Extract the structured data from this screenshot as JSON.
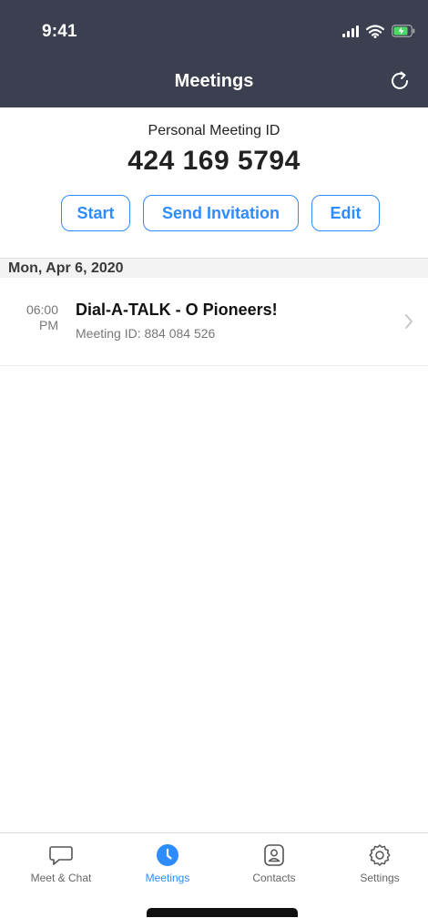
{
  "status_bar": {
    "time": "9:41"
  },
  "nav": {
    "title": "Meetings",
    "refresh_icon": "refresh-icon"
  },
  "personal_meeting": {
    "label": "Personal Meeting ID",
    "id": "424 169 5794",
    "buttons": {
      "start": "Start",
      "send_invitation": "Send Invitation",
      "edit": "Edit"
    }
  },
  "meetings": {
    "date_header": "Mon, Apr 6, 2020",
    "items": [
      {
        "time": "06:00",
        "ampm": "PM",
        "title": "Dial-A-TALK - O Pioneers!",
        "meeting_id": "Meeting ID: 884 084 526"
      }
    ]
  },
  "tabs": [
    {
      "label": "Meet & Chat",
      "icon": "chat-bubble-icon",
      "active": false
    },
    {
      "label": "Meetings",
      "icon": "clock-icon",
      "active": true
    },
    {
      "label": "Contacts",
      "icon": "contact-card-icon",
      "active": false
    },
    {
      "label": "Settings",
      "icon": "gear-icon",
      "active": false
    }
  ],
  "colors": {
    "nav_bg": "#3b3f50",
    "accent": "#2d8cff"
  }
}
